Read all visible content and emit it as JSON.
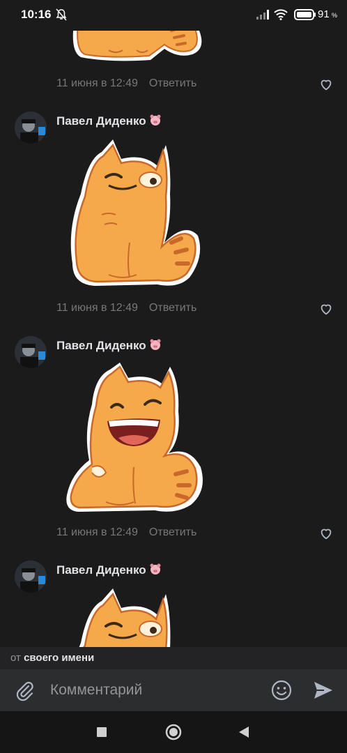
{
  "status_bar": {
    "time": "10:16",
    "battery_percent": "91",
    "battery_sign": "%",
    "icons": [
      "bell-off-icon",
      "signal-icon",
      "wifi-icon",
      "battery-icon"
    ]
  },
  "comments": [
    {
      "date": "11 июня в 12:49",
      "reply_label": "Ответить",
      "sticker": "cat-sticker-partial"
    },
    {
      "author": "Павел Диденко",
      "date": "11 июня в 12:49",
      "reply_label": "Ответить",
      "sticker": "cat-sticker-smirk"
    },
    {
      "author": "Павел Диденко",
      "date": "11 июня в 12:49",
      "reply_label": "Ответить",
      "sticker": "cat-sticker-laugh"
    },
    {
      "author": "Павел Диденко",
      "sticker": "cat-sticker-smirk"
    }
  ],
  "from_bar": {
    "prefix": "от",
    "name": "своего имени"
  },
  "input": {
    "placeholder": "Комментарий"
  },
  "colors": {
    "background": "#1b1b1c",
    "cat_fill": "#f5a94a",
    "cat_outline": "#c8692b",
    "accent_icons": "#aeb7c2"
  }
}
